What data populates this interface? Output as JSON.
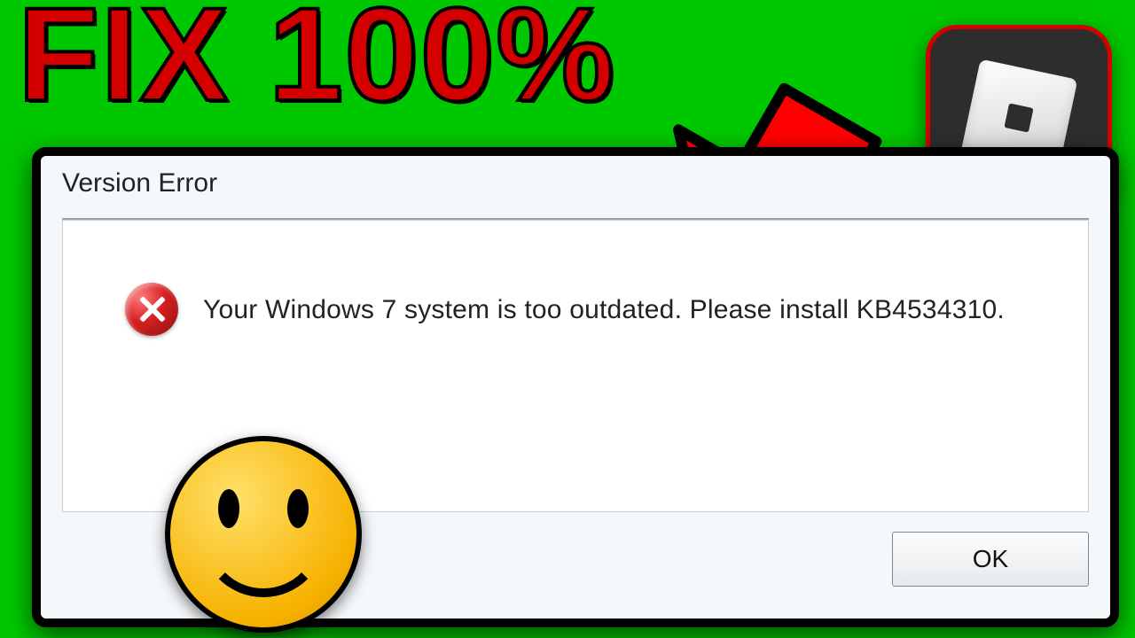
{
  "headline": "FIX 100%",
  "dialog": {
    "title": "Version Error",
    "message": "Your Windows 7 system is too outdated. Please install KB4534310.",
    "ok_label": "OK"
  },
  "icons": {
    "app": "roblox-icon",
    "error": "error-cross-icon",
    "smiley": "smiley-face-icon",
    "arrow": "red-arrow-icon"
  },
  "colors": {
    "background": "#00c800",
    "headline": "#d40000",
    "arrow": "#ff0000"
  }
}
